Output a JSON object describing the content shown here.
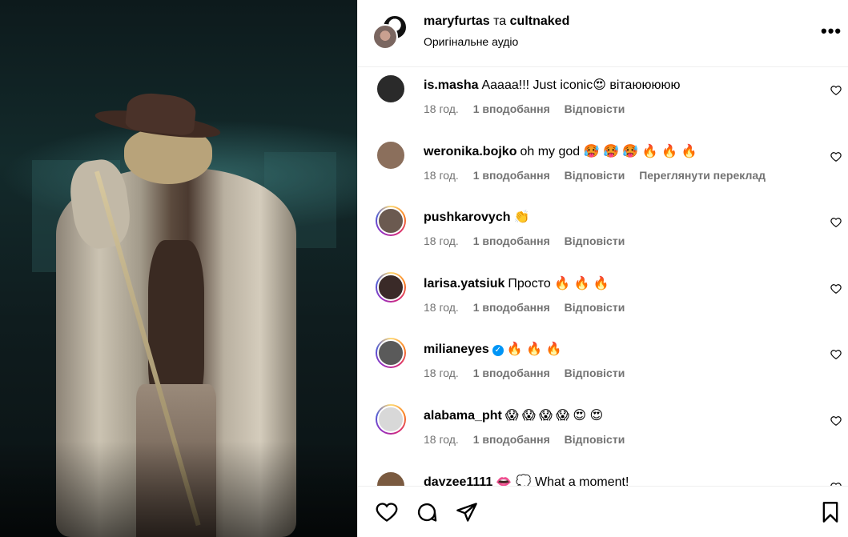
{
  "header": {
    "user1": "maryfurtas",
    "joiner": "та",
    "user2": "cultnaked",
    "subtitle": "Оригінальне аудіо",
    "more": "•••"
  },
  "comments": [
    {
      "user": "is.masha",
      "text": "Aaaaa!!! Just iconic😍 вітаююююю",
      "time": "18 год.",
      "likes": "1 вподобання",
      "reply": "Відповісти",
      "translate": "",
      "ring": false,
      "avatar_color": "#2a2a2a"
    },
    {
      "user": "weronika.bojko",
      "text": "oh my god 🥵 🥵 🥵 🔥 🔥 🔥",
      "time": "18 год.",
      "likes": "1 вподобання",
      "reply": "Відповісти",
      "translate": "Переглянути переклад",
      "ring": false,
      "avatar_color": "#8b6f5c"
    },
    {
      "user": "pushkarovych",
      "text": "👏",
      "time": "18 год.",
      "likes": "1 вподобання",
      "reply": "Відповісти",
      "translate": "",
      "ring": true,
      "avatar_color": "#6b5a50"
    },
    {
      "user": "larisa.yatsiuk",
      "text": "Просто 🔥 🔥 🔥",
      "time": "18 год.",
      "likes": "1 вподобання",
      "reply": "Відповісти",
      "translate": "",
      "ring": true,
      "avatar_color": "#3a2a28"
    },
    {
      "user": "milianeyes",
      "text": "🔥 🔥 🔥",
      "time": "18 год.",
      "likes": "1 вподобання",
      "reply": "Відповісти",
      "translate": "",
      "ring": true,
      "avatar_color": "#5a5a5a",
      "verified": true
    },
    {
      "user": "alabama_pht",
      "text": "😱 😱 😱 😱 😍 😍",
      "time": "18 год.",
      "likes": "1 вподобання",
      "reply": "Відповісти",
      "translate": "",
      "ring": true,
      "avatar_color": "#d8d8d8"
    },
    {
      "user": "dayzee1111",
      "text": "👄 💭 What a moment!",
      "time": "",
      "likes": "",
      "reply": "",
      "translate": "",
      "ring": false,
      "avatar_color": "#7a5a40"
    }
  ],
  "icons": {
    "like": "heart-icon",
    "comment": "comment-icon",
    "share": "share-icon",
    "save": "bookmark-icon"
  }
}
